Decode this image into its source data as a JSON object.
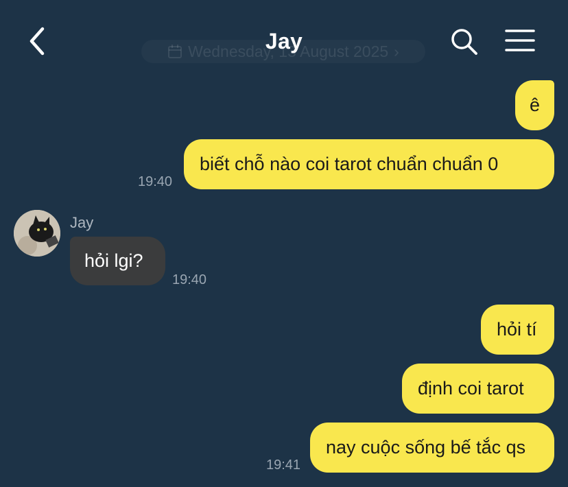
{
  "header": {
    "title": "Jay",
    "date_label": "Wednesday, 13 August 2025",
    "back_icon": "chevron-left-icon",
    "search_icon": "search-icon",
    "menu_icon": "hamburger-menu-icon"
  },
  "messages": {
    "m1": {
      "text": "ê"
    },
    "m2": {
      "text": "biết chỗ nào coi tarot chuẩn chuẩn 0",
      "time": "19:40"
    },
    "m3": {
      "sender": "Jay",
      "text": "hỏi lgi?",
      "time": "19:40"
    },
    "m4": {
      "text": "hỏi tí"
    },
    "m5": {
      "text": "định coi tarot"
    },
    "m6": {
      "text": "nay cuộc sống bế tắc qs",
      "time": "19:41"
    }
  },
  "colors": {
    "background": "#1d3347",
    "outgoing_bubble": "#f9e74e",
    "incoming_bubble": "#3b3c3d",
    "timestamp": "#9aa6b2"
  }
}
